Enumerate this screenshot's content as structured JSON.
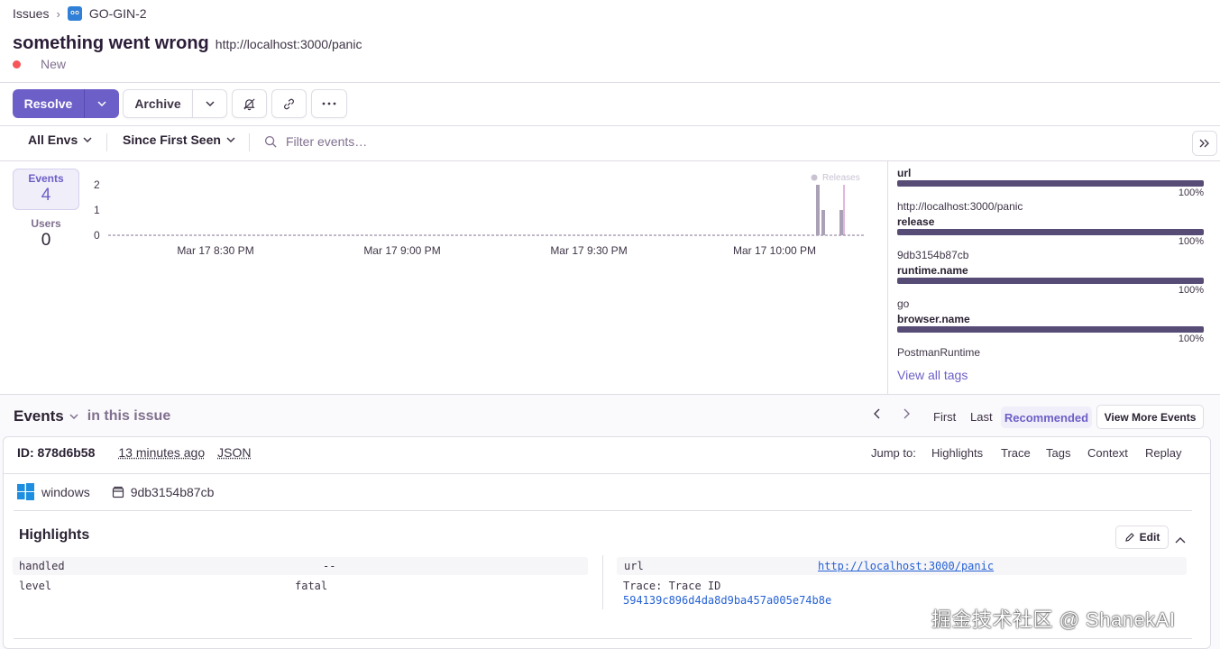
{
  "breadcrumb": {
    "root": "Issues",
    "project": "GO-GIN-2"
  },
  "issue": {
    "title": "something went wrong",
    "url": "http://localhost:3000/panic",
    "status": "New",
    "status_color": "#f55459"
  },
  "actions": {
    "resolve": "Resolve",
    "archive": "Archive"
  },
  "filters": {
    "env": "All Envs",
    "time": "Since First Seen",
    "search_placeholder": "Filter events…"
  },
  "stats": {
    "events_label": "Events",
    "events_value": "4",
    "users_label": "Users",
    "users_value": "0"
  },
  "chart_data": {
    "type": "bar",
    "y_ticks": [
      "0",
      "1",
      "2"
    ],
    "ylim": [
      0,
      2
    ],
    "x_ticks": [
      "Mar 17 8:30 PM",
      "Mar 17 9:00 PM",
      "Mar 17 9:30 PM",
      "Mar 17 10:00 PM"
    ],
    "legend": "Releases",
    "series": [
      {
        "values": [
          2,
          1,
          1
        ]
      }
    ]
  },
  "tags": [
    {
      "key": "url",
      "pct": "100%",
      "value": "http://localhost:3000/panic"
    },
    {
      "key": "release",
      "pct": "100%",
      "value": "9db3154b87cb"
    },
    {
      "key": "runtime.name",
      "pct": "100%",
      "value": "go"
    },
    {
      "key": "browser.name",
      "pct": "100%",
      "value": "PostmanRuntime"
    }
  ],
  "view_all_tags": "View all tags",
  "events": {
    "title": "Events",
    "subtitle": "in this issue",
    "pager": {
      "first": "First",
      "last": "Last",
      "recommended": "Recommended",
      "view_more": "View More Events"
    },
    "id_label": "ID: 878d6b58",
    "time_ago": "13 minutes ago",
    "json": "JSON",
    "jump": {
      "label": "Jump to:",
      "highlights": "Highlights",
      "trace": "Trace",
      "tags": "Tags",
      "context": "Context",
      "replay": "Replay"
    },
    "os": "windows",
    "release": "9db3154b87cb"
  },
  "highlights": {
    "title": "Highlights",
    "edit": "Edit",
    "left": [
      {
        "key": "handled",
        "value": "--"
      },
      {
        "key": "level",
        "value": "fatal"
      }
    ],
    "right": {
      "url_key": "url",
      "url_value": "http://localhost:3000/panic",
      "trace_label": "Trace: Trace ID",
      "trace_id": "594139c896d4da8d9ba457a005e74b8e"
    }
  },
  "watermark": "掘金技术社区 @ ShanekAI"
}
